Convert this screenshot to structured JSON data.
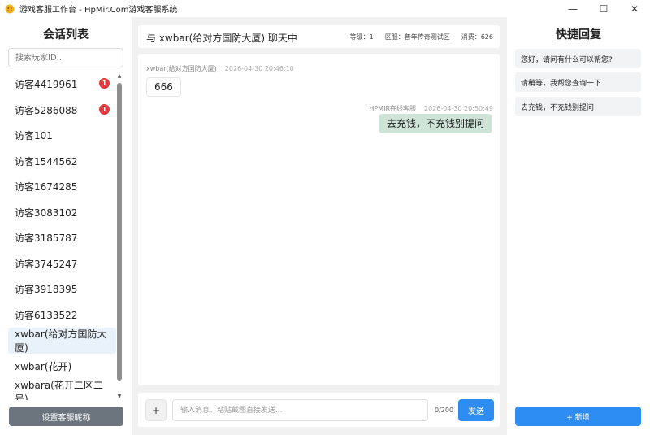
{
  "window": {
    "title": "游戏客服工作台 - HpMir.Com游戏客服系统",
    "minimize": "—",
    "maximize": "☐",
    "close": "✕"
  },
  "sidebar": {
    "title": "会话列表",
    "search_placeholder": "搜索玩家ID...",
    "items": [
      {
        "label": "访客4419961",
        "badge": "1"
      },
      {
        "label": "访客5286088",
        "badge": "1"
      },
      {
        "label": "访客101"
      },
      {
        "label": "访客1544562"
      },
      {
        "label": "访客1674285"
      },
      {
        "label": "访客3083102"
      },
      {
        "label": "访客3185787"
      },
      {
        "label": "访客3745247"
      },
      {
        "label": "访客3918395"
      },
      {
        "label": "访客6133522"
      },
      {
        "label": "xwbar(给对方国防大厦)",
        "active": true
      },
      {
        "label": "xwbar(花开)"
      },
      {
        "label": "xwbara(花开二区二号)"
      }
    ],
    "set_nickname_label": "设置客服昵称"
  },
  "chat": {
    "title": "与 xwbar(给对方国防大厦) 聊天中",
    "level": "等级：1",
    "zone": "区服：普年传奇测试区",
    "spend": "消费：626",
    "messages": [
      {
        "sender": "xwbar(给对方国防大厦)",
        "time": "2026-04-30 20:46:10",
        "text": "666"
      },
      {
        "sender": "HPMIR在线客服",
        "time": "2026-04-30 20:50:49",
        "text": "去充钱，不充钱别提问"
      }
    ],
    "attach_label": "+",
    "input_placeholder": "输入消息、粘贴截图直接发送...",
    "counter": "0/200",
    "send_label": "发送"
  },
  "quick_reply": {
    "title": "快捷回复",
    "items": [
      "您好，请问有什么可以帮您?",
      "请稍等，我帮您查询一下",
      "去充钱，不充钱别提问"
    ],
    "add_label": "+ 新增"
  },
  "colors": {
    "accent": "#2e8df2",
    "badge": "#e03c3c",
    "bubble_out": "#cde4d6"
  }
}
